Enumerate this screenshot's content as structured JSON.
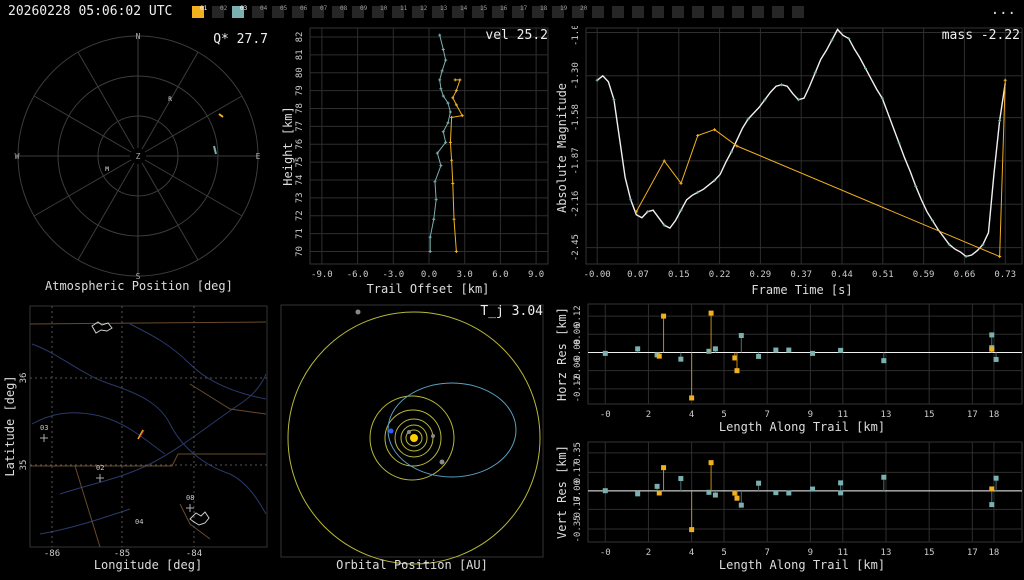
{
  "header": {
    "timestamp": "20260228 05:06:02 UTC",
    "menu": "...",
    "stations": [
      {
        "label": "01",
        "state": "yellow"
      },
      {
        "label": "02",
        "state": "off"
      },
      {
        "label": "03",
        "state": "cyan"
      },
      {
        "label": "04",
        "state": "off"
      },
      {
        "label": "05",
        "state": "off"
      },
      {
        "label": "06",
        "state": "off"
      },
      {
        "label": "07",
        "state": "off"
      },
      {
        "label": "08",
        "state": "off"
      },
      {
        "label": "09",
        "state": "off"
      },
      {
        "label": "10",
        "state": "off"
      },
      {
        "label": "11",
        "state": "off"
      },
      {
        "label": "12",
        "state": "off"
      },
      {
        "label": "13",
        "state": "off"
      },
      {
        "label": "14",
        "state": "off"
      },
      {
        "label": "15",
        "state": "off"
      },
      {
        "label": "16",
        "state": "off"
      },
      {
        "label": "17",
        "state": "off"
      },
      {
        "label": "18",
        "state": "off"
      },
      {
        "label": "19",
        "state": "off"
      },
      {
        "label": "20",
        "state": "off"
      },
      {
        "label": "",
        "state": "off"
      },
      {
        "label": "",
        "state": "off"
      },
      {
        "label": "",
        "state": "off"
      },
      {
        "label": "",
        "state": "off"
      },
      {
        "label": "",
        "state": "off"
      },
      {
        "label": "",
        "state": "off"
      },
      {
        "label": "",
        "state": "off"
      },
      {
        "label": "",
        "state": "off"
      },
      {
        "label": "",
        "state": "off"
      },
      {
        "label": "",
        "state": "off"
      },
      {
        "label": "",
        "state": "off"
      }
    ]
  },
  "colors": {
    "yellow": "#f0b020",
    "cyan": "#7ab0b0",
    "white": "#f0f0f0",
    "grid": "#3a3a3a"
  },
  "panels": {
    "sky": {
      "title": "Atmospheric Position [deg]",
      "value": "Q* 27.7",
      "cardinals": {
        "n": "N",
        "s": "S",
        "e": "E",
        "w": "W",
        "zenith": "Z"
      },
      "station_marks": [
        "R",
        "M"
      ]
    },
    "height": {
      "value": "vel 25.2",
      "xlabel": "Trail Offset [km]",
      "ylabel": "Height [km]",
      "xticks": [
        "-9.0",
        "-6.0",
        "-3.0",
        "0.0",
        "3.0",
        "6.0",
        "9.0"
      ],
      "yticks": [
        "70",
        "71",
        "72",
        "73",
        "74",
        "75",
        "76",
        "77",
        "78",
        "79",
        "80",
        "81",
        "82"
      ]
    },
    "lightcurve": {
      "value": "mass -2.22",
      "xlabel": "Frame Time [s]",
      "ylabel": "Absolute Magnitude",
      "xticks": [
        "-0.00",
        "0.07",
        "0.15",
        "0.22",
        "0.29",
        "0.37",
        "0.44",
        "0.51",
        "0.59",
        "0.66",
        "0.73"
      ],
      "yticks": [
        "-2.45",
        "-2.16",
        "-1.87",
        "-1.58",
        "-1.30",
        "-1.01"
      ]
    },
    "map": {
      "xlabel": "Longitude [deg]",
      "ylabel": "Latitude [deg]",
      "xticks": [
        "-86",
        "-85",
        "-84"
      ],
      "yticks": [
        "36",
        "35"
      ],
      "station_labels": [
        "03",
        "02",
        "08",
        "04"
      ]
    },
    "orbit": {
      "title": "Orbital Position [AU]",
      "value": "T_j 3.04"
    },
    "horz": {
      "xlabel": "Length Along Trail [km]",
      "ylabel": "Horz Res [km]",
      "xticks": [
        "-0",
        "2",
        "4",
        "5",
        "7",
        "9",
        "11",
        "13",
        "15",
        "17",
        "18"
      ],
      "yticks": [
        "0.12",
        "0.06",
        "-0.00",
        "-0.06",
        "-0.12"
      ]
    },
    "vert": {
      "xlabel": "Length Along Trail [km]",
      "ylabel": "Vert Res [km]",
      "xticks": [
        "-0",
        "2",
        "4",
        "5",
        "7",
        "9",
        "11",
        "13",
        "15",
        "17",
        "18"
      ],
      "yticks": [
        "0.35",
        "0.17",
        "0.00",
        "-0.17",
        "-0.35"
      ]
    }
  },
  "chart_data": [
    {
      "type": "line",
      "panel": "height",
      "xlim": [
        -10,
        10
      ],
      "ylim": [
        69.3,
        82.5
      ],
      "series": [
        {
          "color": "cyan",
          "x": [
            0.1,
            0.1,
            0.4,
            0.6,
            0.5,
            1.0,
            0.7,
            1.4,
            1.2,
            1.6,
            1.8,
            1.6,
            1.2,
            1.0,
            0.9,
            1.1,
            1.4,
            1.2,
            0.9
          ],
          "y": [
            70.0,
            70.8,
            71.8,
            72.9,
            73.9,
            74.8,
            75.5,
            76.1,
            76.7,
            77.2,
            77.8,
            78.3,
            78.7,
            79.1,
            79.6,
            80.1,
            80.7,
            81.3,
            82.1
          ]
        },
        {
          "color": "yellow",
          "x": [
            2.3,
            2.1,
            2.0,
            1.9,
            1.8,
            1.9,
            2.8,
            2.3,
            2.0,
            2.3,
            2.6,
            2.2
          ],
          "y": [
            70.0,
            71.8,
            73.8,
            75.1,
            76.1,
            77.5,
            77.6,
            78.2,
            78.6,
            79.0,
            79.6,
            79.6
          ]
        }
      ]
    },
    {
      "type": "line",
      "panel": "lightcurve",
      "xlim": [
        -0.02,
        0.76
      ],
      "ylim": [
        -2.56,
        -0.98
      ],
      "series": [
        {
          "name": "",
          "color": "white",
          "x": [
            -0.0,
            0.01,
            0.02,
            0.03,
            0.04,
            0.05,
            0.06,
            0.07,
            0.08,
            0.09,
            0.1,
            0.11,
            0.12,
            0.13,
            0.14,
            0.15,
            0.16,
            0.17,
            0.18,
            0.19,
            0.2,
            0.21,
            0.22,
            0.23,
            0.24,
            0.25,
            0.26,
            0.27,
            0.28,
            0.29,
            0.3,
            0.31,
            0.32,
            0.33,
            0.34,
            0.35,
            0.36,
            0.37,
            0.38,
            0.39,
            0.4,
            0.41,
            0.42,
            0.43,
            0.44,
            0.45,
            0.46,
            0.47,
            0.48,
            0.49,
            0.5,
            0.51,
            0.52,
            0.53,
            0.54,
            0.55,
            0.56,
            0.57,
            0.58,
            0.59,
            0.6,
            0.61,
            0.62,
            0.63,
            0.64,
            0.65,
            0.66,
            0.67,
            0.68,
            0.69,
            0.7,
            0.71,
            0.72,
            0.73
          ],
          "y": [
            -1.33,
            -1.3,
            -1.34,
            -1.46,
            -1.72,
            -1.98,
            -2.13,
            -2.23,
            -2.25,
            -2.21,
            -2.2,
            -2.25,
            -2.3,
            -2.32,
            -2.27,
            -2.2,
            -2.13,
            -2.1,
            -2.08,
            -2.06,
            -2.03,
            -2.0,
            -1.96,
            -1.88,
            -1.81,
            -1.73,
            -1.65,
            -1.59,
            -1.55,
            -1.51,
            -1.46,
            -1.41,
            -1.37,
            -1.36,
            -1.37,
            -1.42,
            -1.46,
            -1.45,
            -1.37,
            -1.28,
            -1.19,
            -1.13,
            -1.06,
            -0.99,
            -1.03,
            -1.05,
            -1.12,
            -1.18,
            -1.25,
            -1.32,
            -1.39,
            -1.45,
            -1.55,
            -1.65,
            -1.75,
            -1.85,
            -1.94,
            -2.04,
            -2.13,
            -2.21,
            -2.27,
            -2.33,
            -2.38,
            -2.43,
            -2.46,
            -2.48,
            -2.51,
            -2.5,
            -2.47,
            -2.43,
            -2.35,
            -1.95,
            -1.6,
            -1.35
          ]
        },
        {
          "name": "",
          "color": "yellow",
          "x": [
            0.07,
            0.12,
            0.15,
            0.18,
            0.21,
            0.25,
            0.72,
            0.73
          ],
          "y": [
            -2.21,
            -1.87,
            -2.02,
            -1.7,
            -1.66,
            -1.77,
            -2.51,
            -1.33
          ]
        }
      ]
    },
    {
      "type": "scatter",
      "panel": "horz",
      "xlim": [
        -0.8,
        19.3
      ],
      "ylim": [
        -0.17,
        0.16
      ],
      "series": [
        {
          "color": "cyan",
          "x": [
            0.0,
            1.5,
            2.4,
            3.5,
            4.8,
            5.1,
            6.3,
            7.1,
            7.9,
            8.5,
            9.6,
            10.9,
            12.9,
            17.9,
            17.9,
            18.1
          ],
          "y": [
            -0.003,
            0.012,
            -0.008,
            -0.022,
            0.004,
            0.012,
            0.056,
            -0.013,
            0.008,
            0.008,
            -0.003,
            0.007,
            -0.027,
            0.058,
            0.016,
            -0.023
          ]
        },
        {
          "color": "yellow",
          "x": [
            2.5,
            2.7,
            4.0,
            4.9,
            6.0,
            6.1,
            17.9
          ],
          "y": [
            -0.012,
            0.12,
            -0.15,
            0.13,
            -0.018,
            -0.06,
            0.011
          ]
        }
      ]
    },
    {
      "type": "scatter",
      "panel": "vert",
      "xlim": [
        -0.8,
        19.3
      ],
      "ylim": [
        -0.47,
        0.45
      ],
      "series": [
        {
          "color": "cyan",
          "x": [
            0.0,
            1.5,
            2.4,
            3.5,
            4.8,
            5.1,
            6.3,
            7.1,
            7.9,
            8.5,
            9.6,
            10.9,
            10.9,
            12.9,
            17.9,
            18.1
          ],
          "y": [
            0.002,
            -0.027,
            0.042,
            0.114,
            -0.013,
            -0.038,
            -0.131,
            0.071,
            -0.016,
            -0.019,
            0.017,
            0.074,
            -0.018,
            0.126,
            -0.126,
            0.117
          ]
        },
        {
          "color": "yellow",
          "x": [
            2.5,
            2.7,
            4.0,
            4.9,
            6.0,
            6.1,
            17.9
          ],
          "y": [
            -0.019,
            0.214,
            -0.356,
            0.26,
            -0.02,
            -0.067,
            0.018
          ]
        }
      ]
    }
  ]
}
